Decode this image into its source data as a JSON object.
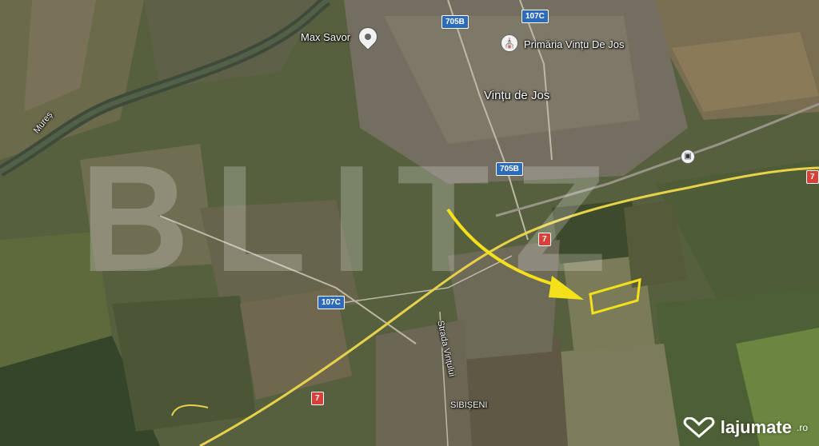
{
  "map": {
    "place_labels": {
      "town": "Vințu de Jos",
      "village": "SIBIȘENI",
      "river": "Mureș",
      "poi_1": "Max Savor",
      "poi_2": "Primăria Vințu De Jos",
      "street": "Strada Vințului"
    },
    "road_shields": {
      "r705b_top": "705B",
      "r107c_top": "107C",
      "r705b_mid": "705B",
      "r7_right": "7",
      "r7_mid": "7",
      "r107c_left": "107C",
      "r7_bottom": "7"
    },
    "icons": {
      "poi_pin": "location-pin-icon",
      "government": "government-building-icon",
      "train": "train-station-icon"
    },
    "overlay": {
      "watermark_text": "BLITZ",
      "annotation_color": "#f5e11a",
      "annotation": "yellow arrow pointing to outlined parcel"
    },
    "brand": {
      "name": "lajumate",
      "tld": ".ro"
    }
  }
}
